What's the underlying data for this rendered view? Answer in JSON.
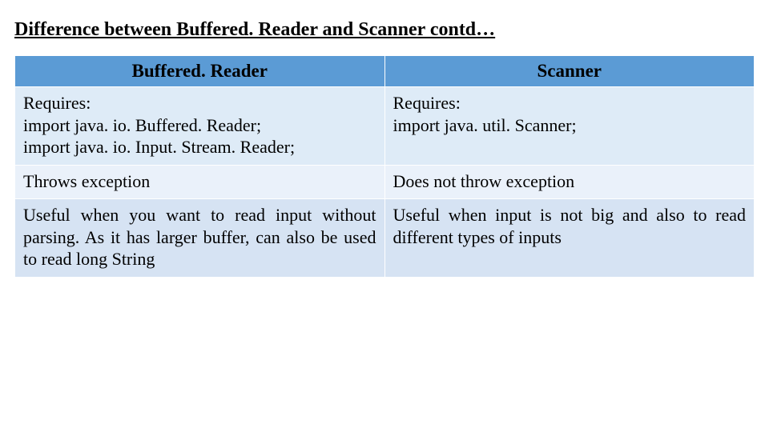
{
  "title": "Difference between Buffered. Reader and Scanner contd…",
  "headers": {
    "left": "Buffered. Reader",
    "right": "Scanner"
  },
  "rows": [
    {
      "left": "Requires:\n import java. io. Buffered. Reader;\n import java. io. Input. Stream. Reader;",
      "right": "Requires:\n import java. util. Scanner;"
    },
    {
      "left": "Throws exception",
      "right": "Does not throw exception"
    },
    {
      "left": "Useful when you want to read input without parsing. As it has larger buffer, can also be used to read long String",
      "right": "Useful when input is not big and also to read different types of inputs"
    }
  ],
  "chart_data": {
    "type": "table",
    "title": "Difference between Buffered.Reader and Scanner contd…",
    "columns": [
      "Buffered. Reader",
      "Scanner"
    ],
    "rows": [
      [
        "Requires: import java.io.Buffered.Reader; import java.io.Input.Stream.Reader;",
        "Requires: import java.util.Scanner;"
      ],
      [
        "Throws exception",
        "Does not throw exception"
      ],
      [
        "Useful when you want to read input without parsing. As it has larger buffer, can also be used to read long String",
        "Useful when input is not big and also to read different types of inputs"
      ]
    ]
  }
}
